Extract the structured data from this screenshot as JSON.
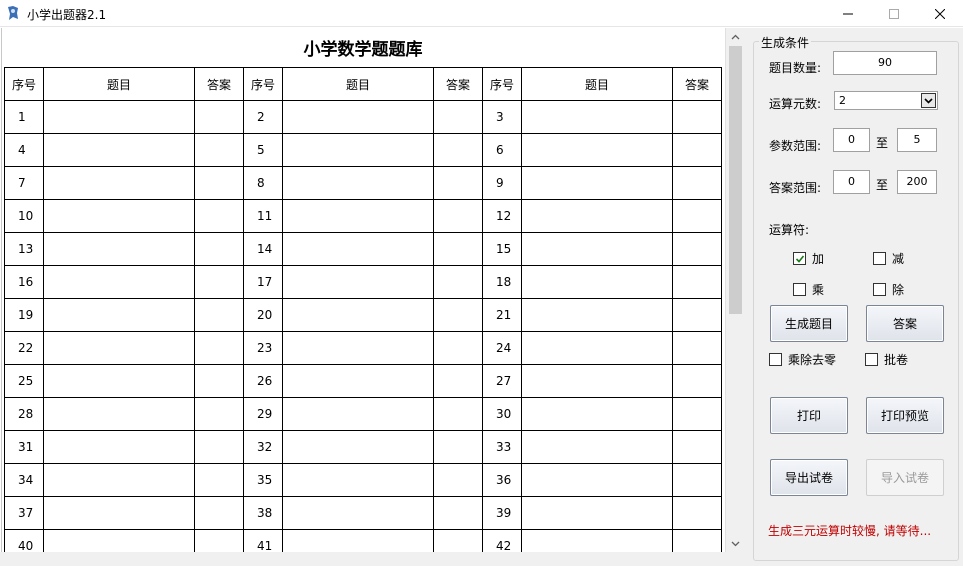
{
  "window": {
    "title": "小学出题器2.1"
  },
  "sheet": {
    "title": "小学数学题题库",
    "headers": [
      "序号",
      "题目",
      "答案",
      "序号",
      "题目",
      "答案",
      "序号",
      "题目",
      "答案"
    ],
    "rows": [
      [
        "1",
        "2",
        "3"
      ],
      [
        "4",
        "5",
        "6"
      ],
      [
        "7",
        "8",
        "9"
      ],
      [
        "10",
        "11",
        "12"
      ],
      [
        "13",
        "14",
        "15"
      ],
      [
        "16",
        "17",
        "18"
      ],
      [
        "19",
        "20",
        "21"
      ],
      [
        "22",
        "23",
        "24"
      ],
      [
        "25",
        "26",
        "27"
      ],
      [
        "28",
        "29",
        "30"
      ],
      [
        "31",
        "32",
        "33"
      ],
      [
        "34",
        "35",
        "36"
      ],
      [
        "37",
        "38",
        "39"
      ],
      [
        "40",
        "41",
        "42"
      ]
    ]
  },
  "panel": {
    "group_title": "生成条件",
    "question_count": {
      "label": "题目数量:",
      "value": "90"
    },
    "operand_count": {
      "label": "运算元数:",
      "value": "2"
    },
    "param_range": {
      "label": "参数范围:",
      "min": "0",
      "separator": "至",
      "max": "5"
    },
    "answer_range": {
      "label": "答案范围:",
      "min": "0",
      "separator": "至",
      "max": "200"
    },
    "operators_label": "运算符:",
    "operators": {
      "add": {
        "label": "加",
        "checked": true
      },
      "subtract": {
        "label": "减",
        "checked": false
      },
      "multiply": {
        "label": "乘",
        "checked": false
      },
      "divide": {
        "label": "除",
        "checked": false
      }
    },
    "generate_button": "生成题目",
    "answer_button": "答案",
    "options": {
      "remove_zero": {
        "label": "乘除去零",
        "checked": false
      },
      "grading": {
        "label": "批卷",
        "checked": false
      }
    },
    "print_button": "打印",
    "print_preview_button": "打印预览",
    "export_button": "导出试卷",
    "import_button": "导入试卷",
    "status_text": "生成三元运算时较慢, 请等待...",
    "status_color": "#c00000"
  }
}
